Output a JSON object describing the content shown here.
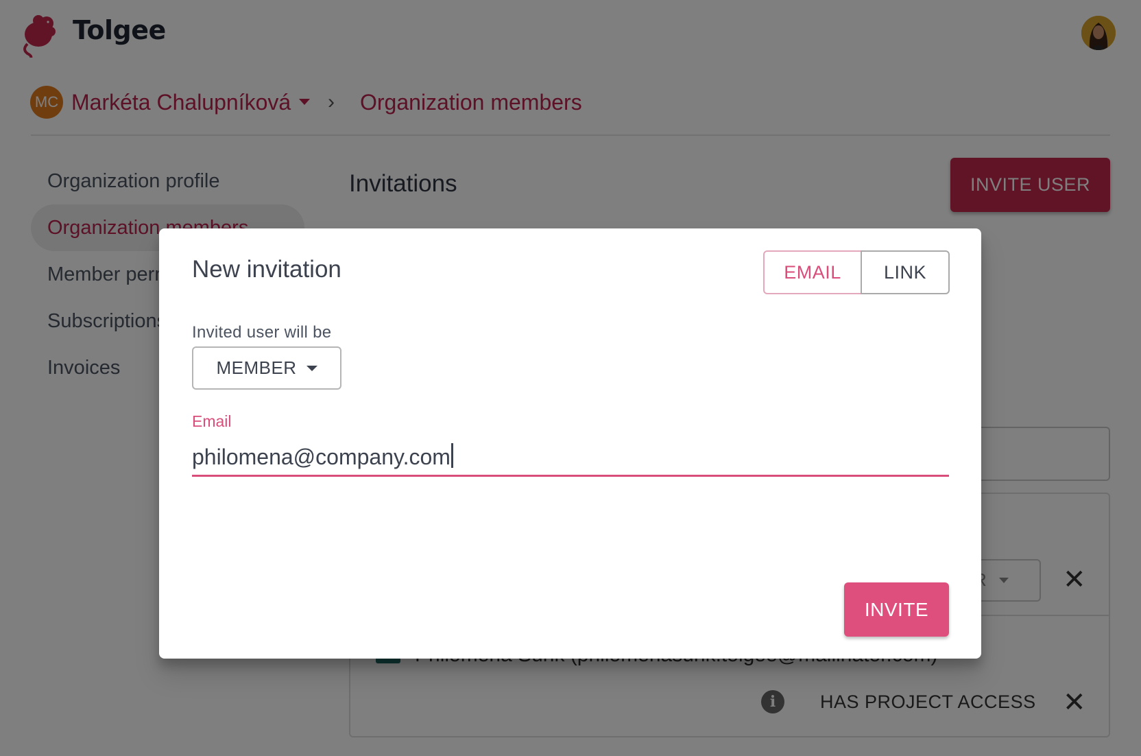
{
  "app": {
    "brand": "Tolgee"
  },
  "colors": {
    "primary": "#c4284f",
    "accent_pink": "#df4f7d",
    "org_avatar": "#e07b1e"
  },
  "breadcrumb": {
    "org_initials": "MC",
    "org_name": "Markéta Chalupníková",
    "separator": "›",
    "current_page": "Organization members"
  },
  "sidebar": {
    "items": [
      {
        "label": "Organization profile",
        "active": false
      },
      {
        "label": "Organization members",
        "active": true
      },
      {
        "label": "Member permissions",
        "active": false
      },
      {
        "label": "Subscriptions",
        "active": false
      },
      {
        "label": "Invoices",
        "active": false
      }
    ]
  },
  "main": {
    "section_title": "Invitations",
    "invite_user_button": "INVITE USER",
    "members": [
      {
        "name": "Philomena Sunk (philomenasunk.tolgee@mailinator.com)",
        "role_partial": "R",
        "access": "HAS PROJECT ACCESS"
      }
    ]
  },
  "dialog": {
    "title": "New invitation",
    "mode_tabs": [
      {
        "label": "EMAIL",
        "selected": true
      },
      {
        "label": "LINK",
        "selected": false
      }
    ],
    "role_label": "Invited user will be",
    "role_value": "MEMBER",
    "email_label": "Email",
    "email_value": "philomena@company.com",
    "submit_label": "INVITE"
  },
  "icons": {
    "close": "✕",
    "info": "i"
  }
}
